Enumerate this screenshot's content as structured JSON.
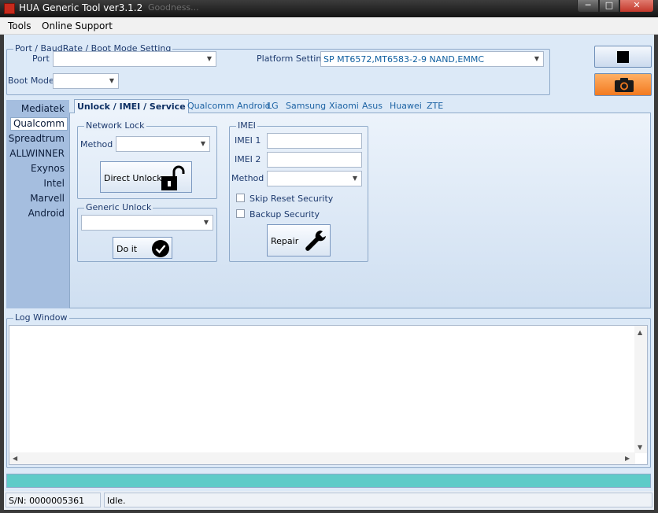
{
  "window": {
    "title": "HUA Generic Tool ver3.1.2",
    "background_title": "Goodness...",
    "controls": {
      "minimize": "─",
      "maximize": "□",
      "close": "✕"
    }
  },
  "menu": [
    "Tools",
    "Online Support"
  ],
  "port_settings": {
    "group_title": "Port / BaudRate / Boot Mode Setting",
    "port_label": "Port",
    "port_value": "",
    "boot_mode_label": "Boot Mode",
    "boot_mode_value": "",
    "platform_label": "Platform Setting",
    "platform_value": "SP MT6572,MT6583-2-9 NAND,EMMC"
  },
  "toolbar": {
    "stop_icon": "stop-icon",
    "camera_icon": "camera-icon"
  },
  "sidebar": {
    "items": [
      "Mediatek",
      "Qualcomm",
      "Spreadtrum",
      "ALLWINNER",
      "Exynos",
      "Intel",
      "Marvell",
      "Android"
    ],
    "active": "Qualcomm"
  },
  "tabs": {
    "items": [
      "Unlock / IMEI / Service",
      "Qualcomm Android",
      "LG",
      "Samsung",
      "Xiaomi",
      "Asus",
      "Huawei",
      "ZTE"
    ],
    "active": "Unlock / IMEI / Service"
  },
  "network_lock": {
    "title": "Network Lock",
    "method_label": "Method",
    "method_value": "",
    "direct_unlock_label": "Direct Unlock"
  },
  "generic_unlock": {
    "title": "Generic Unlock",
    "value": "",
    "do_it_label": "Do it"
  },
  "imei": {
    "title": "IMEI",
    "imei1_label": "IMEI 1",
    "imei1_value": "",
    "imei2_label": "IMEI 2",
    "imei2_value": "",
    "method_label": "Method",
    "method_value": "",
    "skip_reset_label": "Skip Reset Security",
    "skip_reset_checked": false,
    "backup_label": "Backup Security",
    "backup_checked": false,
    "repair_label": "Repair"
  },
  "log": {
    "title": "Log Window",
    "content": ""
  },
  "progress": {
    "fraction": 1.0,
    "color": "#5ecbc8"
  },
  "status": {
    "serial": "S/N: 0000005361",
    "state": "Idle."
  }
}
